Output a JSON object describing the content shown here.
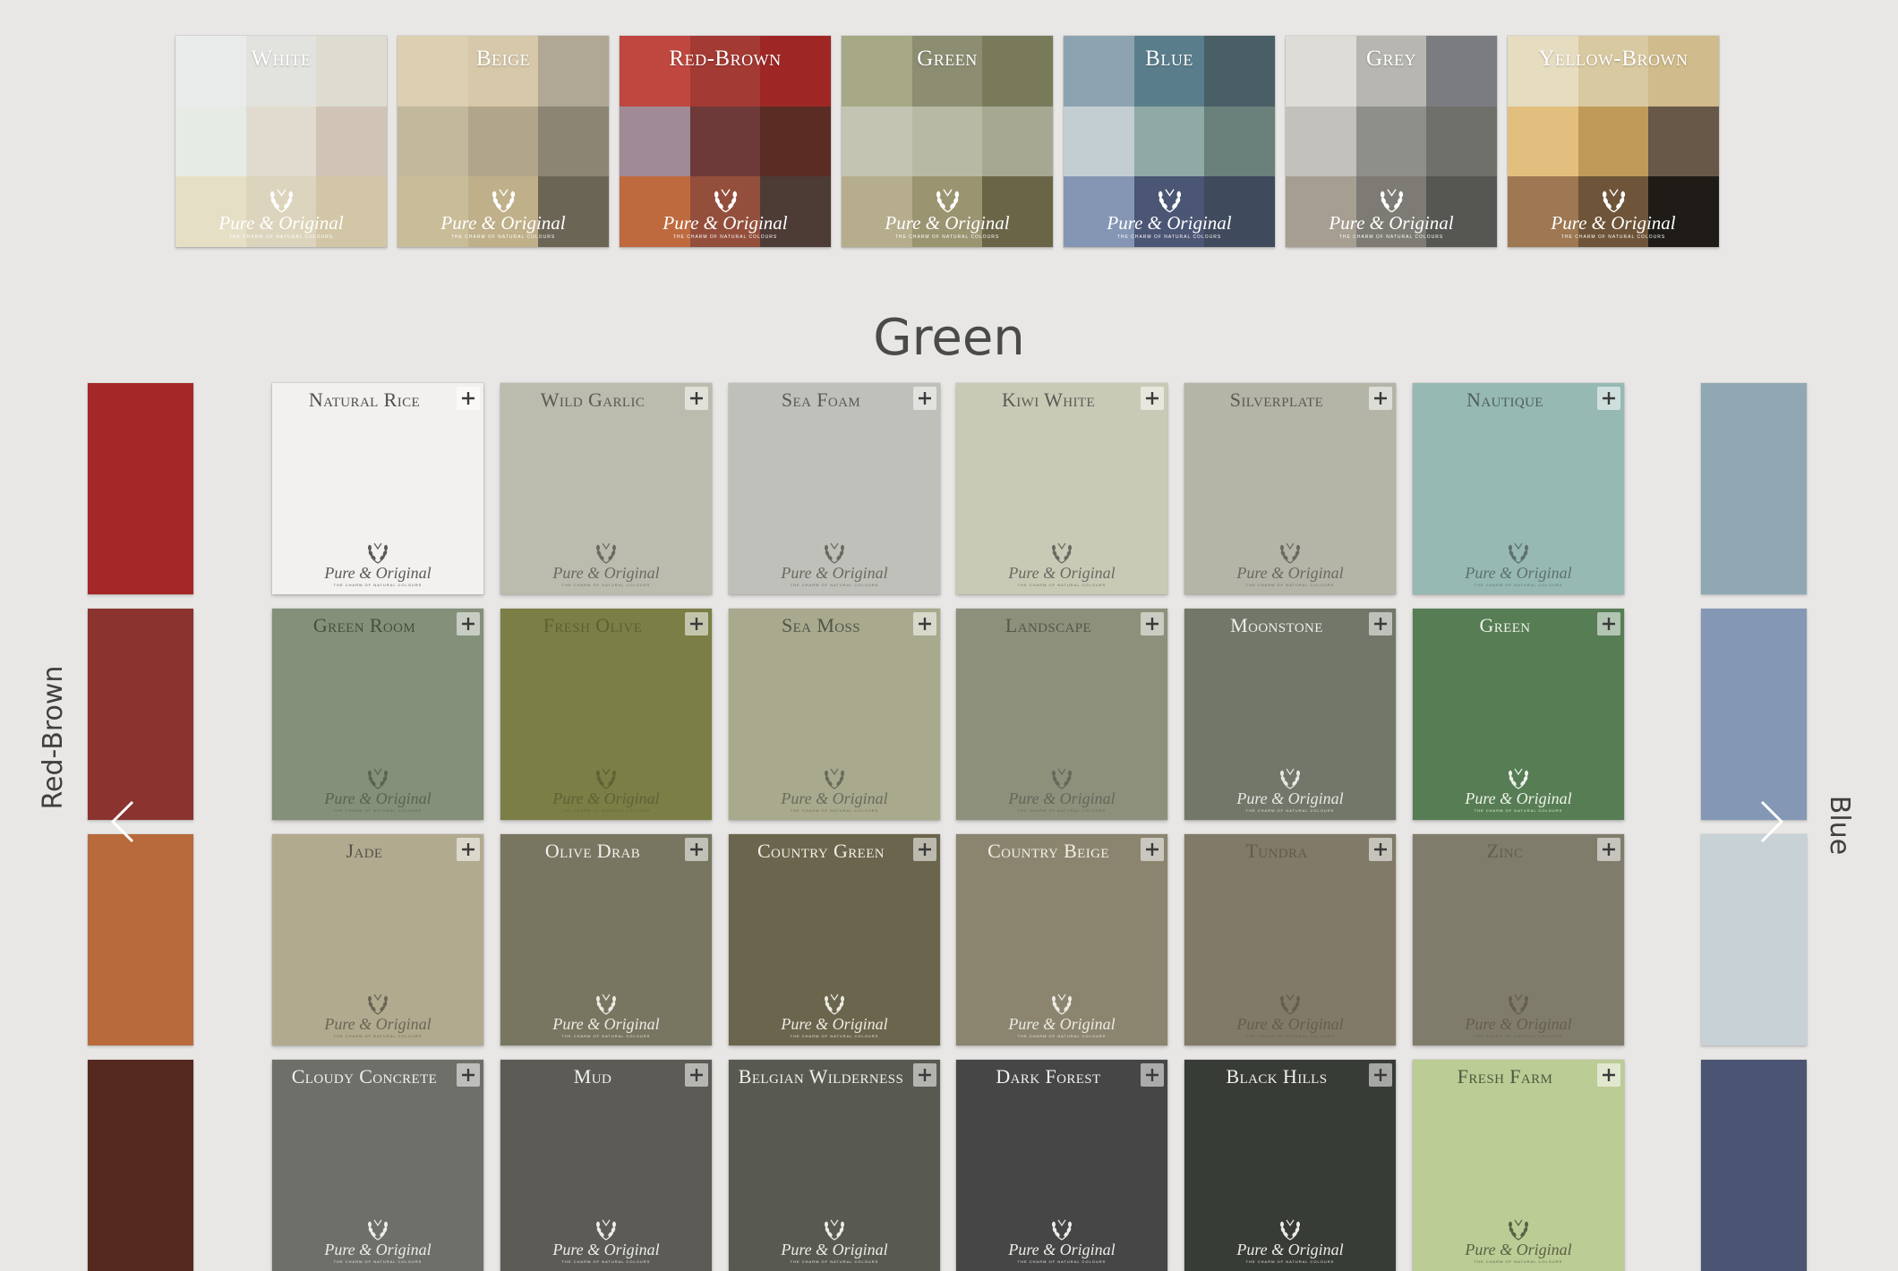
{
  "brand": {
    "name": "Pure & Original",
    "tagline": "THE CHARM OF NATURAL COLOURS"
  },
  "families": [
    {
      "label": "White",
      "cells": [
        "#e9ecea",
        "#e2e3de",
        "#dedcd1",
        "#e7ebe5",
        "#e0dbce",
        "#d0c4b7",
        "#e5dfc6",
        "#dcd4bc",
        "#d2c6a6"
      ]
    },
    {
      "label": "Beige",
      "cells": [
        "#ddcfb2",
        "#d6c8a9",
        "#b1a795",
        "#c2b99d",
        "#b1a68b",
        "#8c8574",
        "#c9bc98",
        "#bfb08a",
        "#6b6556"
      ]
    },
    {
      "label": "Red-Brown",
      "cells": [
        "#c0473f",
        "#a33a33",
        "#9e2725",
        "#9f8a95",
        "#6e3a39",
        "#5a2c23",
        "#be6a3e",
        "#934f3c",
        "#4d3b36"
      ]
    },
    {
      "label": "Green",
      "cells": [
        "#a7a885",
        "#8d8d72",
        "#787a5a",
        "#c3c4b1",
        "#b8b9a5",
        "#a6a891",
        "#b6ad8c",
        "#9b9471",
        "#6b6547"
      ]
    },
    {
      "label": "Blue",
      "cells": [
        "#8ea3b1",
        "#5a7d8c",
        "#4a5e66",
        "#c2ced2",
        "#8fa9a4",
        "#6a807b",
        "#8596b4",
        "#4b5574",
        "#3f4a5d"
      ]
    },
    {
      "label": "Grey",
      "cells": [
        "#dddcd6",
        "#b7b6b0",
        "#7a7c80",
        "#c3c1bb",
        "#8f8f89",
        "#6f706a",
        "#a59e91",
        "#7d7b74",
        "#565752"
      ]
    },
    {
      "label": "Yellow-Brown",
      "cells": [
        "#e6dcc0",
        "#d9c9a0",
        "#cfbb8b",
        "#e3bf7f",
        "#bf9a59",
        "#675847",
        "#9e7852",
        "#6e5438",
        "#1f1c18"
      ]
    }
  ],
  "section_title": "Green",
  "prev_family": {
    "label": "Red-Brown",
    "swatches": [
      "#a52727",
      "#8a332f",
      "#b96a3c",
      "#56291f"
    ]
  },
  "next_family": {
    "label": "Blue",
    "swatches": [
      "#90a8b4",
      "#8498b6",
      "#c8d2d6",
      "#4b5573"
    ]
  },
  "swatches": [
    {
      "name": "Natural Rice",
      "color": "#f3f1ef",
      "ink": "#4e4e4c",
      "logo_ink": "#5a5a58"
    },
    {
      "name": "Wild Garlic",
      "color": "#bcbcae",
      "ink": "#5a5a54",
      "logo_ink": "#6a6a62"
    },
    {
      "name": "Sea Foam",
      "color": "#bfc0b9",
      "ink": "#5a5a54",
      "logo_ink": "#6a6a62"
    },
    {
      "name": "Kiwi White",
      "color": "#c9cab6",
      "ink": "#5a5a54",
      "logo_ink": "#6a6a62"
    },
    {
      "name": "Silverplate",
      "color": "#b4b4a7",
      "ink": "#5a5a54",
      "logo_ink": "#6a6a62"
    },
    {
      "name": "Nautique",
      "color": "#96b9b4",
      "ink": "#4f5e5c",
      "logo_ink": "#5f706d"
    },
    {
      "name": "Green Room",
      "color": "#849079",
      "ink": "#46503f",
      "logo_ink": "#59654f"
    },
    {
      "name": "Fresh Olive",
      "color": "#7b7e45",
      "ink": "#5d6033",
      "logo_ink": "#5f6235"
    },
    {
      "name": "Sea Moss",
      "color": "#a8a98d",
      "ink": "#53544a",
      "logo_ink": "#6a6b5c"
    },
    {
      "name": "Landscape",
      "color": "#8d907b",
      "ink": "#54574a",
      "logo_ink": "#65685a"
    },
    {
      "name": "Moonstone",
      "color": "#727769",
      "ink": "#eeeeea",
      "logo_ink": "#e8e8e4"
    },
    {
      "name": "Green",
      "color": "#567d54",
      "ink": "#eef2ea",
      "logo_ink": "#eef2ea"
    },
    {
      "name": "Jade",
      "color": "#b1aa8f",
      "ink": "#55514a",
      "logo_ink": "#6b6555"
    },
    {
      "name": "Olive Drab",
      "color": "#787661",
      "ink": "#f1f0ea",
      "logo_ink": "#ecebe4"
    },
    {
      "name": "Country Green",
      "color": "#6b654d",
      "ink": "#f1efe6",
      "logo_ink": "#ecebe2"
    },
    {
      "name": "Country Beige",
      "color": "#8b8570",
      "ink": "#f1efe6",
      "logo_ink": "#ecebe2"
    },
    {
      "name": "Tundra",
      "color": "#817a68",
      "ink": "#615b4c",
      "logo_ink": "#645e4e"
    },
    {
      "name": "Zinc",
      "color": "#807c6c",
      "ink": "#615d52",
      "logo_ink": "#645f52"
    },
    {
      "name": "Cloudy Concrete",
      "color": "#6e6f69",
      "ink": "#f1f1ee",
      "logo_ink": "#ecece8"
    },
    {
      "name": "Mud",
      "color": "#5c5b55",
      "ink": "#f1f1ee",
      "logo_ink": "#ecece8"
    },
    {
      "name": "Belgian Wilderness",
      "color": "#585a51",
      "ink": "#f1f1ee",
      "logo_ink": "#ecece8"
    },
    {
      "name": "Dark Forest",
      "color": "#464646",
      "ink": "#f1f1ee",
      "logo_ink": "#ecece8"
    },
    {
      "name": "Black Hills",
      "color": "#383c36",
      "ink": "#f1f1ee",
      "logo_ink": "#ecece8"
    },
    {
      "name": "Fresh Farm",
      "color": "#bccc95",
      "ink": "#50573e",
      "logo_ink": "#5a6244"
    }
  ]
}
